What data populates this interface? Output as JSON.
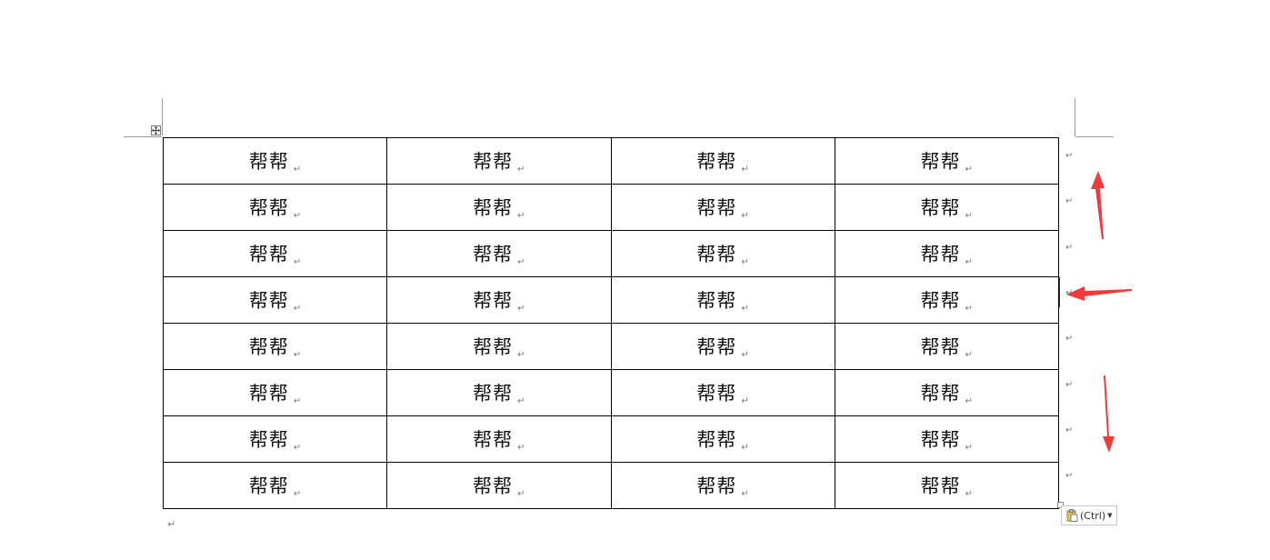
{
  "table": {
    "rows": [
      [
        "帮帮",
        "帮帮",
        "帮帮",
        "帮帮"
      ],
      [
        "帮帮",
        "帮帮",
        "帮帮",
        "帮帮"
      ],
      [
        "帮帮",
        "帮帮",
        "帮帮",
        "帮帮"
      ],
      [
        "帮帮",
        "帮帮",
        "帮帮",
        "帮帮"
      ],
      [
        "帮帮",
        "帮帮",
        "帮帮",
        "帮帮"
      ],
      [
        "帮帮",
        "帮帮",
        "帮帮",
        "帮帮"
      ],
      [
        "帮帮",
        "帮帮",
        "帮帮",
        "帮帮"
      ],
      [
        "帮帮",
        "帮帮",
        "帮帮",
        "帮帮"
      ]
    ],
    "cell_mark": "↵",
    "row_end_mark": "↵"
  },
  "paragraph_mark": "↵",
  "paste_options": {
    "label": "(Ctrl)",
    "dropdown_icon": "triangle-down-icon"
  },
  "colors": {
    "arrow": "#ef3b3b",
    "border": "#000000",
    "mark": "#777777"
  }
}
